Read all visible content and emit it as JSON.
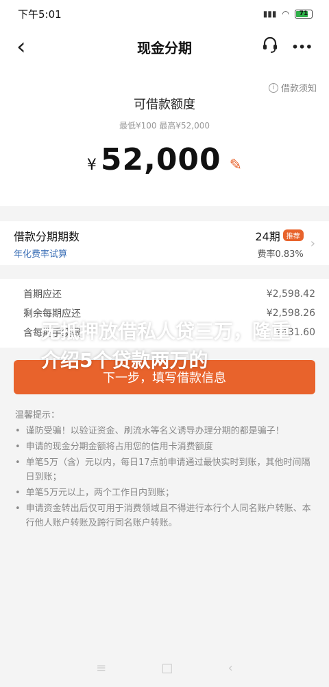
{
  "status": {
    "time": "下午5:01",
    "signal": "📶",
    "wifi": "📶",
    "battery": "71"
  },
  "nav": {
    "back": "‹",
    "title": "现金分期",
    "service": "🎧",
    "more": "•••"
  },
  "amount": {
    "notice": "借款须知",
    "title": "可借款额度",
    "range": "最低¥100  最高¥52,000",
    "currency": "¥",
    "value": "52,000",
    "edit": "✎"
  },
  "term": {
    "label": "借款分期期数",
    "rate_link": "年化费率试算",
    "value": "24期",
    "badge": "推荐",
    "fee_rate": "费率0.83%"
  },
  "repay": [
    {
      "label": "首期应还",
      "value": "¥2,598.42"
    },
    {
      "label": "剩余每期应还",
      "value": "¥2,598.26"
    },
    {
      "label": "含每期手续费",
      "value": "¥431.60"
    }
  ],
  "next_button": "下一步，填写借款信息",
  "tips": {
    "title": "温馨提示：",
    "items": [
      "谨防受骗！以验证资金、刷流水等名义诱导办理分期的都是骗子！",
      "申请的现金分期金额将占用您的信用卡消费额度",
      "单笔5万（含）元以内，每日17点前申请通过最快实时到账，其他时间隔日到账；",
      "单笔5万元以上，两个工作日内到账；",
      "申请资金转出后仅可用于消费领域且不得进行本行个人同名账户转账、本行他人账户转账及跨行同名账户转账。"
    ]
  },
  "overlay": "无抵押放借私人贷三万，隆重介绍5个贷款两万的",
  "bottom_nav": {
    "menu": "≡",
    "home": "□",
    "back": "‹"
  },
  "colors": {
    "accent": "#e8632c",
    "link": "#3b6fb6"
  }
}
